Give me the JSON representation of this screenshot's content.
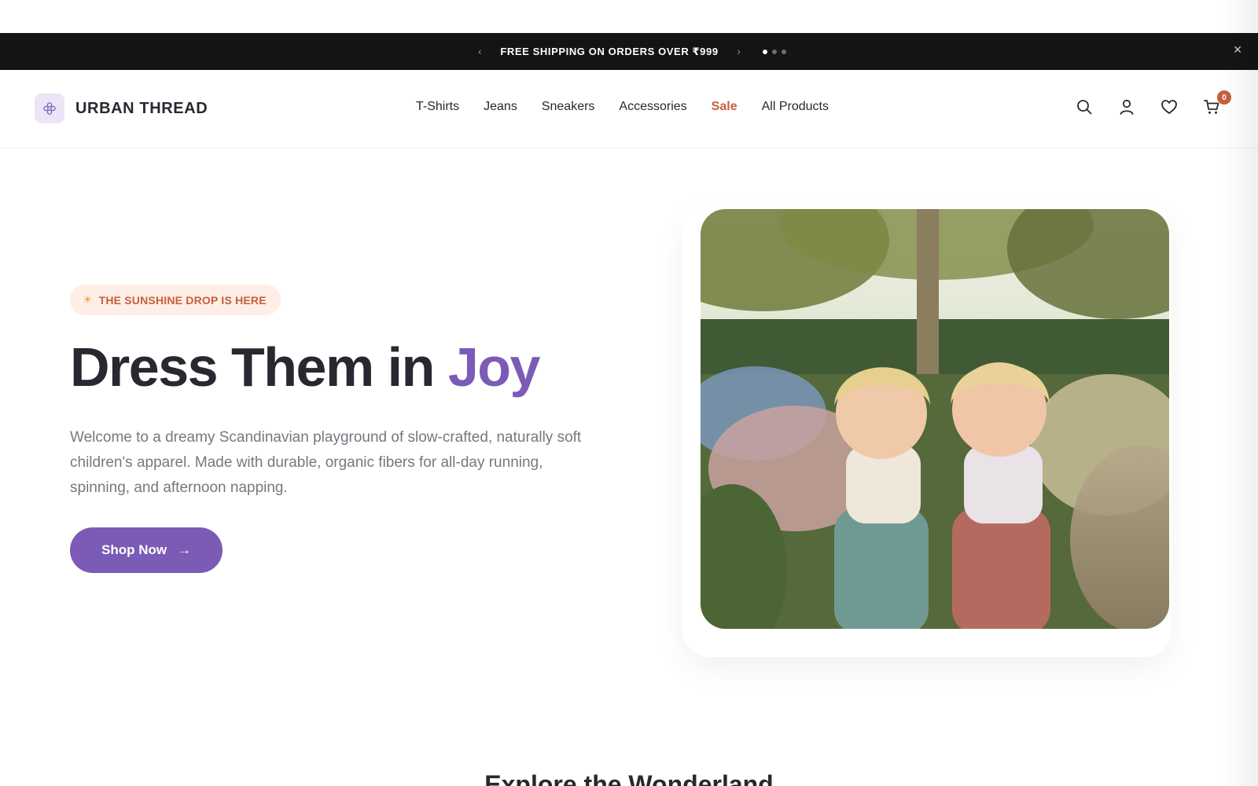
{
  "announcement": {
    "text": "FREE SHIPPING ON ORDERS OVER ₹999",
    "prev_icon": "chevron-left-icon",
    "next_icon": "chevron-right-icon",
    "prev_glyph": "‹",
    "next_glyph": "›",
    "close_glyph": "✕",
    "dots_total": 3,
    "active_dot": 1
  },
  "header": {
    "brand_name": "URBAN THREAD",
    "logo_icon": "flower-icon",
    "nav": [
      {
        "label": "T-Shirts"
      },
      {
        "label": "Jeans"
      },
      {
        "label": "Sneakers"
      },
      {
        "label": "Accessories"
      },
      {
        "label": "Sale"
      },
      {
        "label": "All Products"
      }
    ],
    "icons": [
      "search-icon",
      "user-icon",
      "heart-icon",
      "cart-icon"
    ],
    "cart_count": "0"
  },
  "hero": {
    "badge_icon": "☀",
    "badge_text": "THE SUNSHINE DROP IS HERE",
    "title_main": "Dress Them in ",
    "title_accent": "Joy",
    "description": "Welcome to a dreamy Scandinavian playground of slow-crafted, naturally soft children's apparel. Made with durable, organic fibers for all-day running, spinning, and afternoon napping.",
    "cta_label": "Shop Now",
    "cta_arrow": "→"
  },
  "next_section": {
    "title": "Explore the Wonderland"
  },
  "colors": {
    "accent_purple": "#7b5bb5",
    "sale_orange": "#c65f3d",
    "bar_black": "#141414",
    "text_dark": "#2a2730"
  }
}
